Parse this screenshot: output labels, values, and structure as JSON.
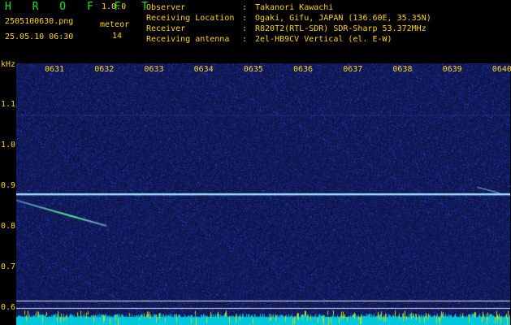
{
  "header": {
    "app_title": "H R O F F T",
    "app_version": "1.0.0",
    "file_name": "2505100630.png",
    "date_time": "25.05.10 06:30",
    "meteor_label": "meteor",
    "meteor_count": "14"
  },
  "info": [
    {
      "key": "Observer",
      "value": "Takanori Kawachi"
    },
    {
      "key": "Receiving Location",
      "value": "Ogaki, Gifu, JAPAN (136.60E, 35.35N)"
    },
    {
      "key": "Receiver",
      "value": "R820T2(RTL-SDR) SDR-Sharp 53.372MHz"
    },
    {
      "key": "Receiving antenna",
      "value": "2el-HB9CV Vertical (el. E-W)"
    }
  ],
  "info_colon": ":",
  "spectrogram": {
    "unit_label": "kHz",
    "y_ticks": [
      "1.1",
      "1.0",
      "0.9",
      "0.8",
      "0.7",
      "0.6"
    ],
    "y_range_khz": [
      0.58,
      1.2
    ],
    "x_ticks": [
      "0631",
      "0632",
      "0633",
      "0634",
      "0635",
      "0636",
      "0637",
      "0638",
      "0639",
      "0640"
    ],
    "x_minutes": [
      1,
      10
    ],
    "carrier_khz": 0.88,
    "meteor_trace": {
      "start_khz": 0.865,
      "end_khz": 0.802,
      "start_min": 0.0,
      "end_min": 2.05
    },
    "colors": {
      "background": "#121a66",
      "carrier": "#a0e6ff",
      "meteor": "#5ef08c",
      "axis_text": "#ffd21a",
      "title": "#19e619",
      "baseline": "#e6e6e6",
      "noise_floor": "#00c8dc",
      "noise_peaks": "#c8dc14"
    }
  }
}
